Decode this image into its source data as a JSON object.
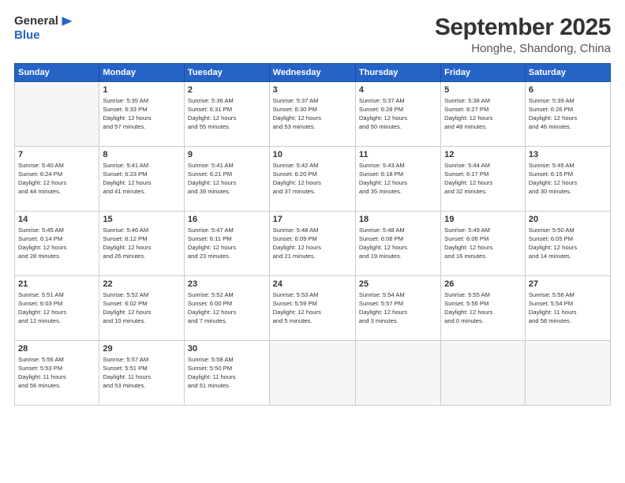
{
  "logo": {
    "line1": "General",
    "line2": "Blue",
    "icon": "▶"
  },
  "title": "September 2025",
  "subtitle": "Honghe, Shandong, China",
  "weekdays": [
    "Sunday",
    "Monday",
    "Tuesday",
    "Wednesday",
    "Thursday",
    "Friday",
    "Saturday"
  ],
  "weeks": [
    [
      {
        "day": "",
        "info": ""
      },
      {
        "day": "1",
        "info": "Sunrise: 5:35 AM\nSunset: 6:33 PM\nDaylight: 12 hours\nand 57 minutes."
      },
      {
        "day": "2",
        "info": "Sunrise: 5:36 AM\nSunset: 6:31 PM\nDaylight: 12 hours\nand 55 minutes."
      },
      {
        "day": "3",
        "info": "Sunrise: 5:37 AM\nSunset: 6:30 PM\nDaylight: 12 hours\nand 53 minutes."
      },
      {
        "day": "4",
        "info": "Sunrise: 5:37 AM\nSunset: 6:28 PM\nDaylight: 12 hours\nand 50 minutes."
      },
      {
        "day": "5",
        "info": "Sunrise: 5:38 AM\nSunset: 6:27 PM\nDaylight: 12 hours\nand 48 minutes."
      },
      {
        "day": "6",
        "info": "Sunrise: 5:39 AM\nSunset: 6:26 PM\nDaylight: 12 hours\nand 46 minutes."
      }
    ],
    [
      {
        "day": "7",
        "info": "Sunrise: 5:40 AM\nSunset: 6:24 PM\nDaylight: 12 hours\nand 44 minutes."
      },
      {
        "day": "8",
        "info": "Sunrise: 5:41 AM\nSunset: 6:23 PM\nDaylight: 12 hours\nand 41 minutes."
      },
      {
        "day": "9",
        "info": "Sunrise: 5:41 AM\nSunset: 6:21 PM\nDaylight: 12 hours\nand 39 minutes."
      },
      {
        "day": "10",
        "info": "Sunrise: 5:42 AM\nSunset: 6:20 PM\nDaylight: 12 hours\nand 37 minutes."
      },
      {
        "day": "11",
        "info": "Sunrise: 5:43 AM\nSunset: 6:18 PM\nDaylight: 12 hours\nand 35 minutes."
      },
      {
        "day": "12",
        "info": "Sunrise: 5:44 AM\nSunset: 6:17 PM\nDaylight: 12 hours\nand 32 minutes."
      },
      {
        "day": "13",
        "info": "Sunrise: 5:45 AM\nSunset: 6:15 PM\nDaylight: 12 hours\nand 30 minutes."
      }
    ],
    [
      {
        "day": "14",
        "info": "Sunrise: 5:45 AM\nSunset: 6:14 PM\nDaylight: 12 hours\nand 28 minutes."
      },
      {
        "day": "15",
        "info": "Sunrise: 5:46 AM\nSunset: 6:12 PM\nDaylight: 12 hours\nand 26 minutes."
      },
      {
        "day": "16",
        "info": "Sunrise: 5:47 AM\nSunset: 6:11 PM\nDaylight: 12 hours\nand 23 minutes."
      },
      {
        "day": "17",
        "info": "Sunrise: 5:48 AM\nSunset: 6:09 PM\nDaylight: 12 hours\nand 21 minutes."
      },
      {
        "day": "18",
        "info": "Sunrise: 5:48 AM\nSunset: 6:08 PM\nDaylight: 12 hours\nand 19 minutes."
      },
      {
        "day": "19",
        "info": "Sunrise: 5:49 AM\nSunset: 6:06 PM\nDaylight: 12 hours\nand 16 minutes."
      },
      {
        "day": "20",
        "info": "Sunrise: 5:50 AM\nSunset: 6:05 PM\nDaylight: 12 hours\nand 14 minutes."
      }
    ],
    [
      {
        "day": "21",
        "info": "Sunrise: 5:51 AM\nSunset: 6:03 PM\nDaylight: 12 hours\nand 12 minutes."
      },
      {
        "day": "22",
        "info": "Sunrise: 5:52 AM\nSunset: 6:02 PM\nDaylight: 12 hours\nand 10 minutes."
      },
      {
        "day": "23",
        "info": "Sunrise: 5:52 AM\nSunset: 6:00 PM\nDaylight: 12 hours\nand 7 minutes."
      },
      {
        "day": "24",
        "info": "Sunrise: 5:53 AM\nSunset: 5:59 PM\nDaylight: 12 hours\nand 5 minutes."
      },
      {
        "day": "25",
        "info": "Sunrise: 5:54 AM\nSunset: 5:57 PM\nDaylight: 12 hours\nand 3 minutes."
      },
      {
        "day": "26",
        "info": "Sunrise: 5:55 AM\nSunset: 5:56 PM\nDaylight: 12 hours\nand 0 minutes."
      },
      {
        "day": "27",
        "info": "Sunrise: 5:56 AM\nSunset: 5:54 PM\nDaylight: 11 hours\nand 58 minutes."
      }
    ],
    [
      {
        "day": "28",
        "info": "Sunrise: 5:56 AM\nSunset: 5:53 PM\nDaylight: 11 hours\nand 56 minutes."
      },
      {
        "day": "29",
        "info": "Sunrise: 5:57 AM\nSunset: 5:51 PM\nDaylight: 11 hours\nand 53 minutes."
      },
      {
        "day": "30",
        "info": "Sunrise: 5:58 AM\nSunset: 5:50 PM\nDaylight: 11 hours\nand 51 minutes."
      },
      {
        "day": "",
        "info": ""
      },
      {
        "day": "",
        "info": ""
      },
      {
        "day": "",
        "info": ""
      },
      {
        "day": "",
        "info": ""
      }
    ]
  ]
}
